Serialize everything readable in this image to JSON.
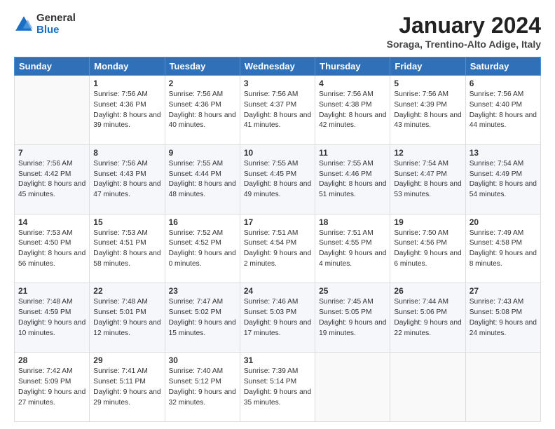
{
  "header": {
    "logo": {
      "general": "General",
      "blue": "Blue"
    },
    "title": "January 2024",
    "location": "Soraga, Trentino-Alto Adige, Italy"
  },
  "days_of_week": [
    "Sunday",
    "Monday",
    "Tuesday",
    "Wednesday",
    "Thursday",
    "Friday",
    "Saturday"
  ],
  "weeks": [
    [
      {
        "day": "",
        "sunrise": "",
        "sunset": "",
        "daylight": ""
      },
      {
        "day": "1",
        "sunrise": "Sunrise: 7:56 AM",
        "sunset": "Sunset: 4:36 PM",
        "daylight": "Daylight: 8 hours and 39 minutes."
      },
      {
        "day": "2",
        "sunrise": "Sunrise: 7:56 AM",
        "sunset": "Sunset: 4:36 PM",
        "daylight": "Daylight: 8 hours and 40 minutes."
      },
      {
        "day": "3",
        "sunrise": "Sunrise: 7:56 AM",
        "sunset": "Sunset: 4:37 PM",
        "daylight": "Daylight: 8 hours and 41 minutes."
      },
      {
        "day": "4",
        "sunrise": "Sunrise: 7:56 AM",
        "sunset": "Sunset: 4:38 PM",
        "daylight": "Daylight: 8 hours and 42 minutes."
      },
      {
        "day": "5",
        "sunrise": "Sunrise: 7:56 AM",
        "sunset": "Sunset: 4:39 PM",
        "daylight": "Daylight: 8 hours and 43 minutes."
      },
      {
        "day": "6",
        "sunrise": "Sunrise: 7:56 AM",
        "sunset": "Sunset: 4:40 PM",
        "daylight": "Daylight: 8 hours and 44 minutes."
      }
    ],
    [
      {
        "day": "7",
        "sunrise": "Sunrise: 7:56 AM",
        "sunset": "Sunset: 4:42 PM",
        "daylight": "Daylight: 8 hours and 45 minutes."
      },
      {
        "day": "8",
        "sunrise": "Sunrise: 7:56 AM",
        "sunset": "Sunset: 4:43 PM",
        "daylight": "Daylight: 8 hours and 47 minutes."
      },
      {
        "day": "9",
        "sunrise": "Sunrise: 7:55 AM",
        "sunset": "Sunset: 4:44 PM",
        "daylight": "Daylight: 8 hours and 48 minutes."
      },
      {
        "day": "10",
        "sunrise": "Sunrise: 7:55 AM",
        "sunset": "Sunset: 4:45 PM",
        "daylight": "Daylight: 8 hours and 49 minutes."
      },
      {
        "day": "11",
        "sunrise": "Sunrise: 7:55 AM",
        "sunset": "Sunset: 4:46 PM",
        "daylight": "Daylight: 8 hours and 51 minutes."
      },
      {
        "day": "12",
        "sunrise": "Sunrise: 7:54 AM",
        "sunset": "Sunset: 4:47 PM",
        "daylight": "Daylight: 8 hours and 53 minutes."
      },
      {
        "day": "13",
        "sunrise": "Sunrise: 7:54 AM",
        "sunset": "Sunset: 4:49 PM",
        "daylight": "Daylight: 8 hours and 54 minutes."
      }
    ],
    [
      {
        "day": "14",
        "sunrise": "Sunrise: 7:53 AM",
        "sunset": "Sunset: 4:50 PM",
        "daylight": "Daylight: 8 hours and 56 minutes."
      },
      {
        "day": "15",
        "sunrise": "Sunrise: 7:53 AM",
        "sunset": "Sunset: 4:51 PM",
        "daylight": "Daylight: 8 hours and 58 minutes."
      },
      {
        "day": "16",
        "sunrise": "Sunrise: 7:52 AM",
        "sunset": "Sunset: 4:52 PM",
        "daylight": "Daylight: 9 hours and 0 minutes."
      },
      {
        "day": "17",
        "sunrise": "Sunrise: 7:51 AM",
        "sunset": "Sunset: 4:54 PM",
        "daylight": "Daylight: 9 hours and 2 minutes."
      },
      {
        "day": "18",
        "sunrise": "Sunrise: 7:51 AM",
        "sunset": "Sunset: 4:55 PM",
        "daylight": "Daylight: 9 hours and 4 minutes."
      },
      {
        "day": "19",
        "sunrise": "Sunrise: 7:50 AM",
        "sunset": "Sunset: 4:56 PM",
        "daylight": "Daylight: 9 hours and 6 minutes."
      },
      {
        "day": "20",
        "sunrise": "Sunrise: 7:49 AM",
        "sunset": "Sunset: 4:58 PM",
        "daylight": "Daylight: 9 hours and 8 minutes."
      }
    ],
    [
      {
        "day": "21",
        "sunrise": "Sunrise: 7:48 AM",
        "sunset": "Sunset: 4:59 PM",
        "daylight": "Daylight: 9 hours and 10 minutes."
      },
      {
        "day": "22",
        "sunrise": "Sunrise: 7:48 AM",
        "sunset": "Sunset: 5:01 PM",
        "daylight": "Daylight: 9 hours and 12 minutes."
      },
      {
        "day": "23",
        "sunrise": "Sunrise: 7:47 AM",
        "sunset": "Sunset: 5:02 PM",
        "daylight": "Daylight: 9 hours and 15 minutes."
      },
      {
        "day": "24",
        "sunrise": "Sunrise: 7:46 AM",
        "sunset": "Sunset: 5:03 PM",
        "daylight": "Daylight: 9 hours and 17 minutes."
      },
      {
        "day": "25",
        "sunrise": "Sunrise: 7:45 AM",
        "sunset": "Sunset: 5:05 PM",
        "daylight": "Daylight: 9 hours and 19 minutes."
      },
      {
        "day": "26",
        "sunrise": "Sunrise: 7:44 AM",
        "sunset": "Sunset: 5:06 PM",
        "daylight": "Daylight: 9 hours and 22 minutes."
      },
      {
        "day": "27",
        "sunrise": "Sunrise: 7:43 AM",
        "sunset": "Sunset: 5:08 PM",
        "daylight": "Daylight: 9 hours and 24 minutes."
      }
    ],
    [
      {
        "day": "28",
        "sunrise": "Sunrise: 7:42 AM",
        "sunset": "Sunset: 5:09 PM",
        "daylight": "Daylight: 9 hours and 27 minutes."
      },
      {
        "day": "29",
        "sunrise": "Sunrise: 7:41 AM",
        "sunset": "Sunset: 5:11 PM",
        "daylight": "Daylight: 9 hours and 29 minutes."
      },
      {
        "day": "30",
        "sunrise": "Sunrise: 7:40 AM",
        "sunset": "Sunset: 5:12 PM",
        "daylight": "Daylight: 9 hours and 32 minutes."
      },
      {
        "day": "31",
        "sunrise": "Sunrise: 7:39 AM",
        "sunset": "Sunset: 5:14 PM",
        "daylight": "Daylight: 9 hours and 35 minutes."
      },
      {
        "day": "",
        "sunrise": "",
        "sunset": "",
        "daylight": ""
      },
      {
        "day": "",
        "sunrise": "",
        "sunset": "",
        "daylight": ""
      },
      {
        "day": "",
        "sunrise": "",
        "sunset": "",
        "daylight": ""
      }
    ]
  ]
}
